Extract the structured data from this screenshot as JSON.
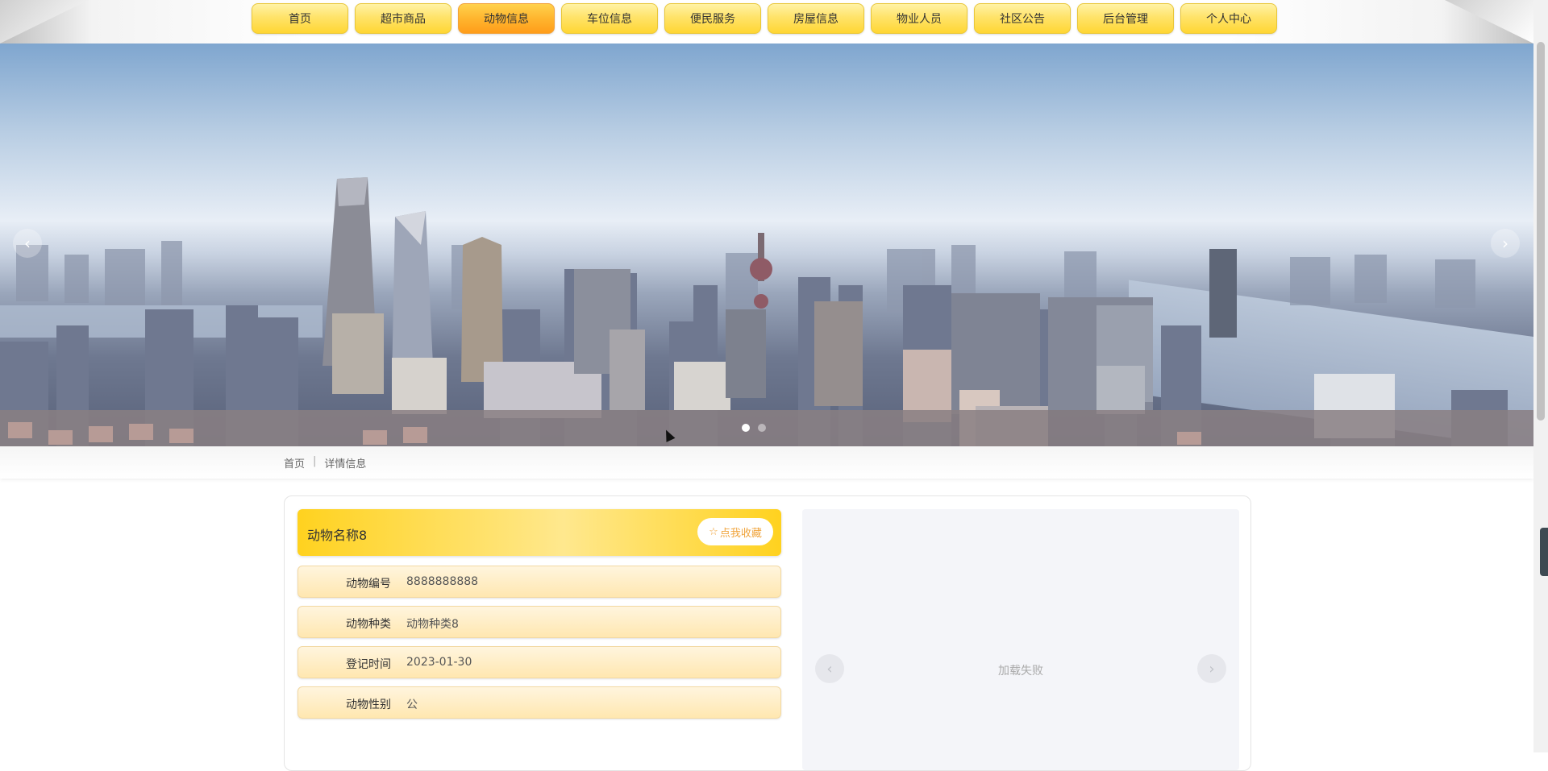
{
  "nav": {
    "items": [
      {
        "label": "首页",
        "active": false
      },
      {
        "label": "超市商品",
        "active": false
      },
      {
        "label": "动物信息",
        "active": true
      },
      {
        "label": "车位信息",
        "active": false
      },
      {
        "label": "便民服务",
        "active": false
      },
      {
        "label": "房屋信息",
        "active": false
      },
      {
        "label": "物业人员",
        "active": false
      },
      {
        "label": "社区公告",
        "active": false
      },
      {
        "label": "后台管理",
        "active": false
      },
      {
        "label": "个人中心",
        "active": false
      }
    ]
  },
  "banner": {
    "prev_icon": "‹",
    "next_icon": "›",
    "active_dot": 0,
    "dot_count": 2
  },
  "breadcrumb": {
    "home": "首页",
    "separator": "|",
    "current": "详情信息"
  },
  "detail": {
    "title": "动物名称8",
    "favorite_label": "点我收藏",
    "favorite_icon": "☆",
    "fields": [
      {
        "label": "动物编号",
        "value": "8888888888"
      },
      {
        "label": "动物种类",
        "value": "动物种类8"
      },
      {
        "label": "登记时间",
        "value": "2023-01-30"
      },
      {
        "label": "动物性别",
        "value": "公"
      }
    ]
  },
  "image_carousel": {
    "status_text": "加载失败",
    "prev_icon": "‹",
    "next_icon": "›"
  },
  "colors": {
    "nav_yellow": "#ffd633",
    "nav_active": "#ff9d1a",
    "favorite_text": "#f0a43c"
  }
}
